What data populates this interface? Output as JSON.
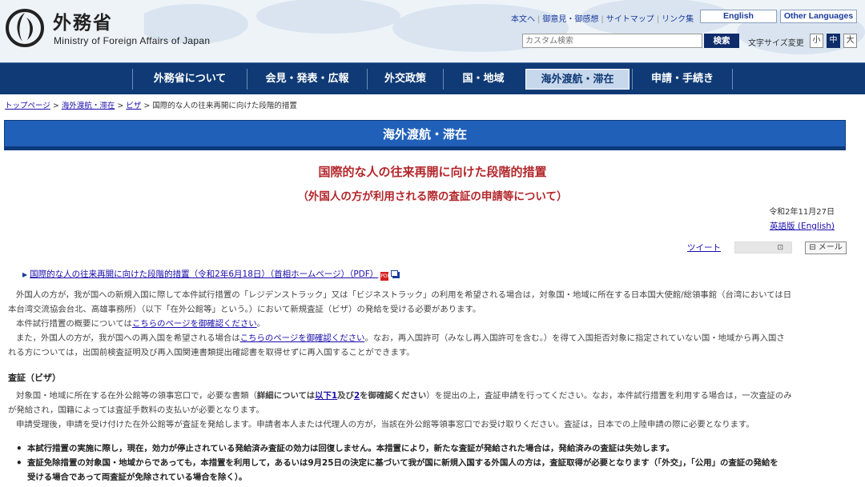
{
  "header": {
    "logo_jp": "外務省",
    "logo_en": "Ministry of Foreign Affairs of Japan",
    "util_links": [
      "本文へ",
      "御意見・御感想",
      "サイトマップ",
      "リンク集"
    ],
    "english_btn": "English",
    "other_lang_btn": "Other Languages",
    "search_placeholder": "カスタム検索",
    "search_btn": "検索",
    "fontsize_label": "文字サイズ変更",
    "fontsize_options": [
      "小",
      "中",
      "大"
    ]
  },
  "gnav": {
    "items": [
      "外務省について",
      "会見・発表・広報",
      "外交政策",
      "国・地域",
      "海外渡航・滞在",
      "申請・手続き"
    ],
    "active_index": 4
  },
  "breadcrumb": {
    "items": [
      "トップページ",
      "海外渡航・滞在",
      "ビザ"
    ],
    "current": "国際的な人の往来再開に向けた段階的措置"
  },
  "section_title": "海外渡航・滞在",
  "main": {
    "title": "国際的な人の往来再開に向けた段階的措置",
    "subtitle": "（外国人の方が利用される際の査証の申請等について）",
    "date": "令和2年11月27日",
    "english_link": "英語版 (English)",
    "tweet": "ツイート",
    "mail_btn": "メール",
    "pdf_link": "国際的な人の往来再開に向けた段階的措置（令和2年6月18日）（首相ホームページ）（PDF）",
    "pdf_icon": "PDF",
    "p1_line1": "外国人の方が，我が国への新規入国に際して本件試行措置の「レジデンストラック」又は「ビジネストラック」の利用を希望される場合は，対象国・地域に所在する日本国大使館/総領事館（台湾においては日",
    "p1_line2": "本台湾交流協会台北、高雄事務所）（以下「在外公館等」という。）において新規査証（ビザ）の発給を受ける必要があります。",
    "p2_pre": "本件試行措置の概要については",
    "p2_link": "こちらのページを御確認ください",
    "p2_post": "。",
    "p3_pre": "また，外国人の方が，我が国への再入国を希望される場合は",
    "p3_link": "こちらのページを御確認ください",
    "p3_post": "。なお，再入国許可（みなし再入国許可を含む。）を得て入国拒否対象に指定されていない国・地域から再入国さ",
    "p3_line2": "れる方については，出国前検査証明及び再入国関連書類提出確認書を取得せずに再入国することができます。",
    "visa_heading": "査証（ビザ）",
    "v1_pre": "対象国・地域に所在する在外公館等の領事窓口で，必要な書類（",
    "v1_bold1": "詳細については",
    "v1_link1": "以下1",
    "v1_bold2": "及び",
    "v1_link2": "2",
    "v1_bold3": "を御確認ください",
    "v1_post": "）を提出の上，査証申請を行ってください。なお，本件試行措置を利用する場合は，一次査証のみ",
    "v1_line2": "が発給され，国籍によっては査証手数料の支払いが必要となります。",
    "v2": "申請受理後，申請を受け付けた在外公館等が査証を発給します。申請者本人または代理人の方が，当該在外公館等領事窓口でお受け取りください。査証は，日本での上陸申請の際に必要となります。",
    "bullet1": "本試行措置の実施に際し，現在，効力が停止されている発給済み査証の効力は回復しません。本措置により，新たな査証が発給された場合は，発給済みの査証は失効します。",
    "bullet2_line1": "査証免除措置の対象国・地域からであっても，本措置を利用して，あるいは9月25日の決定に基づいて我が国に新規入国する外国人の方は，査証取得が必要となります（「外交」，「公用」の査証の発給を",
    "bullet2_line2": "受ける場合であって両査証が免除されている場合を除く）。"
  },
  "colors": {
    "nav_bg": "#0f3a75",
    "section_bar": "#2060b8",
    "title_red": "#b3262b",
    "link_blue": "#1a0dab"
  }
}
